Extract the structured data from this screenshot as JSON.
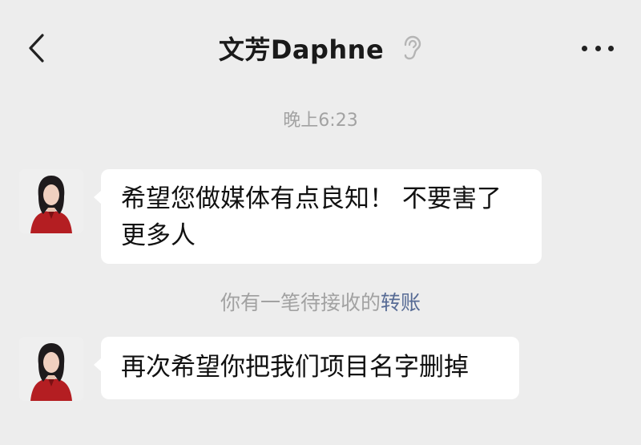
{
  "header": {
    "title": "文芳Daphne",
    "back_icon": "chevron-left-icon",
    "ear_icon": "ear-icon",
    "more_icon": "more-dots-icon"
  },
  "timestamp": "晚上6:23",
  "messages": [
    {
      "sender": "other",
      "text": "希望您做媒体有点良知！ 不要害了更多人"
    },
    {
      "sender": "other",
      "text": "再次希望你把我们项目名字删掉"
    }
  ],
  "transfer_notice": {
    "text": "你有一笔待接收的",
    "link": "转账"
  },
  "colors": {
    "background": "#ededed",
    "bubble": "#ffffff",
    "timestamp": "#a2a2a2",
    "link": "#576b95"
  }
}
